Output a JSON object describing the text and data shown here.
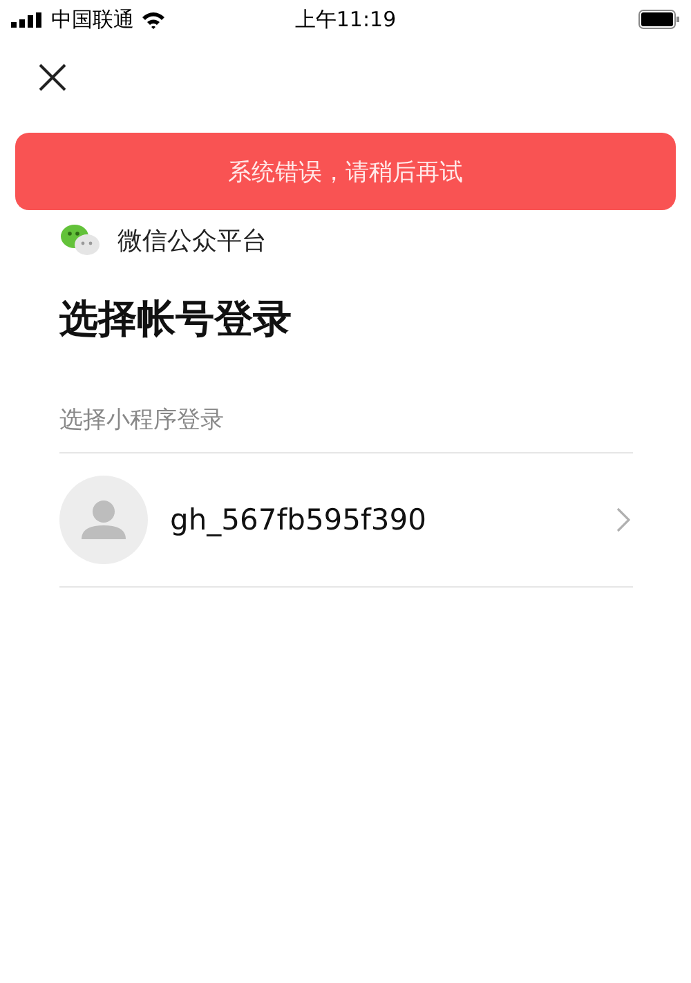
{
  "status_bar": {
    "carrier": "中国联通",
    "time": "上午11:19"
  },
  "toast": {
    "message": "系统错误，请稍后再试"
  },
  "brand": {
    "name": "微信公众平台"
  },
  "title": "选择帐号登录",
  "section": {
    "label": "选择小程序登录",
    "accounts": [
      {
        "name": "gh_567fb595f390"
      }
    ]
  }
}
